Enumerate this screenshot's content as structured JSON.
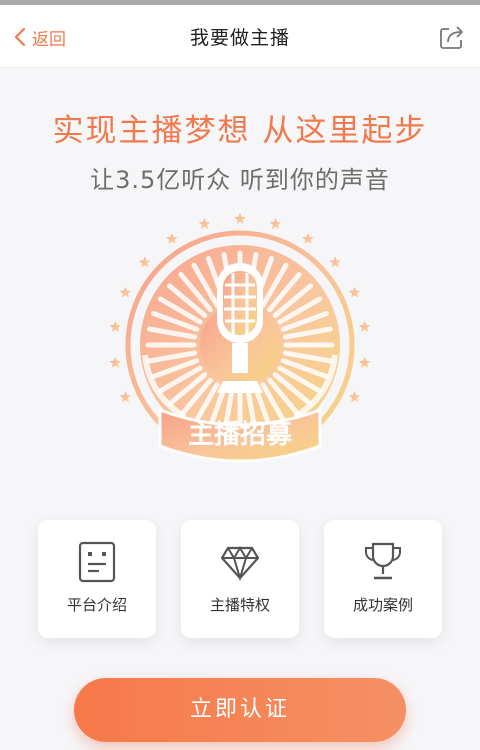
{
  "nav": {
    "back_label": "返回",
    "title": "我要做主播"
  },
  "hero": {
    "headline": "实现主播梦想 从这里起步",
    "subline": "让3.5亿听众 听到你的声音",
    "badge_text": "主播招募"
  },
  "cards": [
    {
      "label": "平台介绍",
      "icon": "document-icon"
    },
    {
      "label": "主播特权",
      "icon": "diamond-icon"
    },
    {
      "label": "成功案例",
      "icon": "trophy-icon"
    }
  ],
  "cta": {
    "label": "立即认证"
  },
  "colors": {
    "accent": "#f07a4b",
    "badge_gradient": [
      "#f7a08a",
      "#f9c59a",
      "#f5d57e"
    ]
  }
}
